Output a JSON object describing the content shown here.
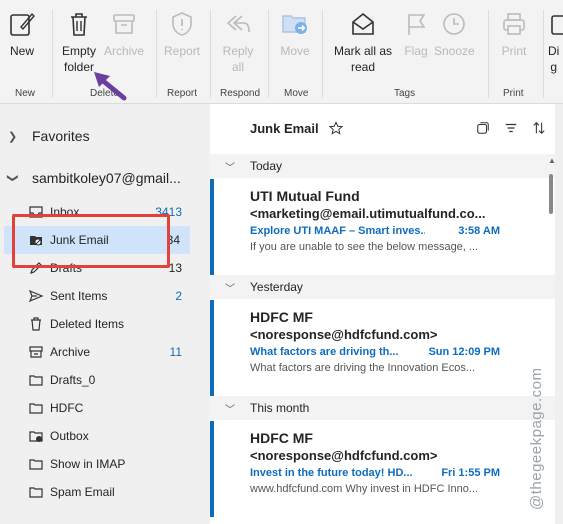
{
  "ribbon": {
    "new": "New",
    "empty_folder": "Empty\nfolder",
    "archive": "Archive",
    "report": "Report",
    "reply_all": "Reply\nall",
    "move": "Move",
    "mark_all_as_read": "Mark all as\nread",
    "flag": "Flag",
    "snooze": "Snooze",
    "print": "Print",
    "partial": "Di\ng",
    "groups": {
      "new": "New",
      "delete": "Delete",
      "report": "Report",
      "respond": "Respond",
      "move": "Move",
      "tags": "Tags",
      "print": "Print"
    }
  },
  "nav": {
    "favorites": "Favorites",
    "account": "sambitkoley07@gmail...",
    "folders": [
      {
        "label": "Inbox",
        "count": "3413",
        "icon": "inbox-icon"
      },
      {
        "label": "Junk Email",
        "count": "34",
        "icon": "junk-icon"
      },
      {
        "label": "Drafts",
        "count": "13",
        "icon": "pencil-icon"
      },
      {
        "label": "Sent Items",
        "count": "2",
        "icon": "send-icon"
      },
      {
        "label": "Deleted Items",
        "count": "",
        "icon": "trash-icon"
      },
      {
        "label": "Archive",
        "count": "11",
        "icon": "archive-icon"
      },
      {
        "label": "Drafts_0",
        "count": "",
        "icon": "folder-icon"
      },
      {
        "label": "HDFC",
        "count": "",
        "icon": "folder-icon"
      },
      {
        "label": "Outbox",
        "count": "",
        "icon": "outbox-icon"
      },
      {
        "label": "Show in IMAP",
        "count": "",
        "icon": "folder-icon"
      },
      {
        "label": "Spam Email",
        "count": "",
        "icon": "folder-icon"
      }
    ]
  },
  "list": {
    "title": "Junk Email",
    "groups": [
      "Today",
      "Yesterday",
      "This month"
    ],
    "messages": [
      {
        "from": "UTI Mutual Fund",
        "address": "<marketing@email.utimutualfund.co...",
        "subject": "Explore UTI MAAF – Smart inves...",
        "time": "3:58 AM",
        "preview": "If you are unable to see the below message, ..."
      },
      {
        "from": "HDFC MF",
        "address": "<noresponse@hdfcfund.com>",
        "subject": "What factors are driving th...",
        "time": "Sun 12:09 PM",
        "preview": "What factors are driving the Innovation Ecos..."
      },
      {
        "from": "HDFC MF",
        "address": "<noresponse@hdfcfund.com>",
        "subject": "Invest in the future today! HD...",
        "time": "Fri 1:55 PM",
        "preview": "www.hdfcfund.com Why invest in HDFC Inno..."
      }
    ]
  },
  "watermark": "@thegeekpage.com",
  "colors": {
    "accent": "#0f6cbd",
    "highlight_box": "#e0433b",
    "arrow": "#6b3fa0",
    "selected_bg": "#cfe4fa"
  }
}
